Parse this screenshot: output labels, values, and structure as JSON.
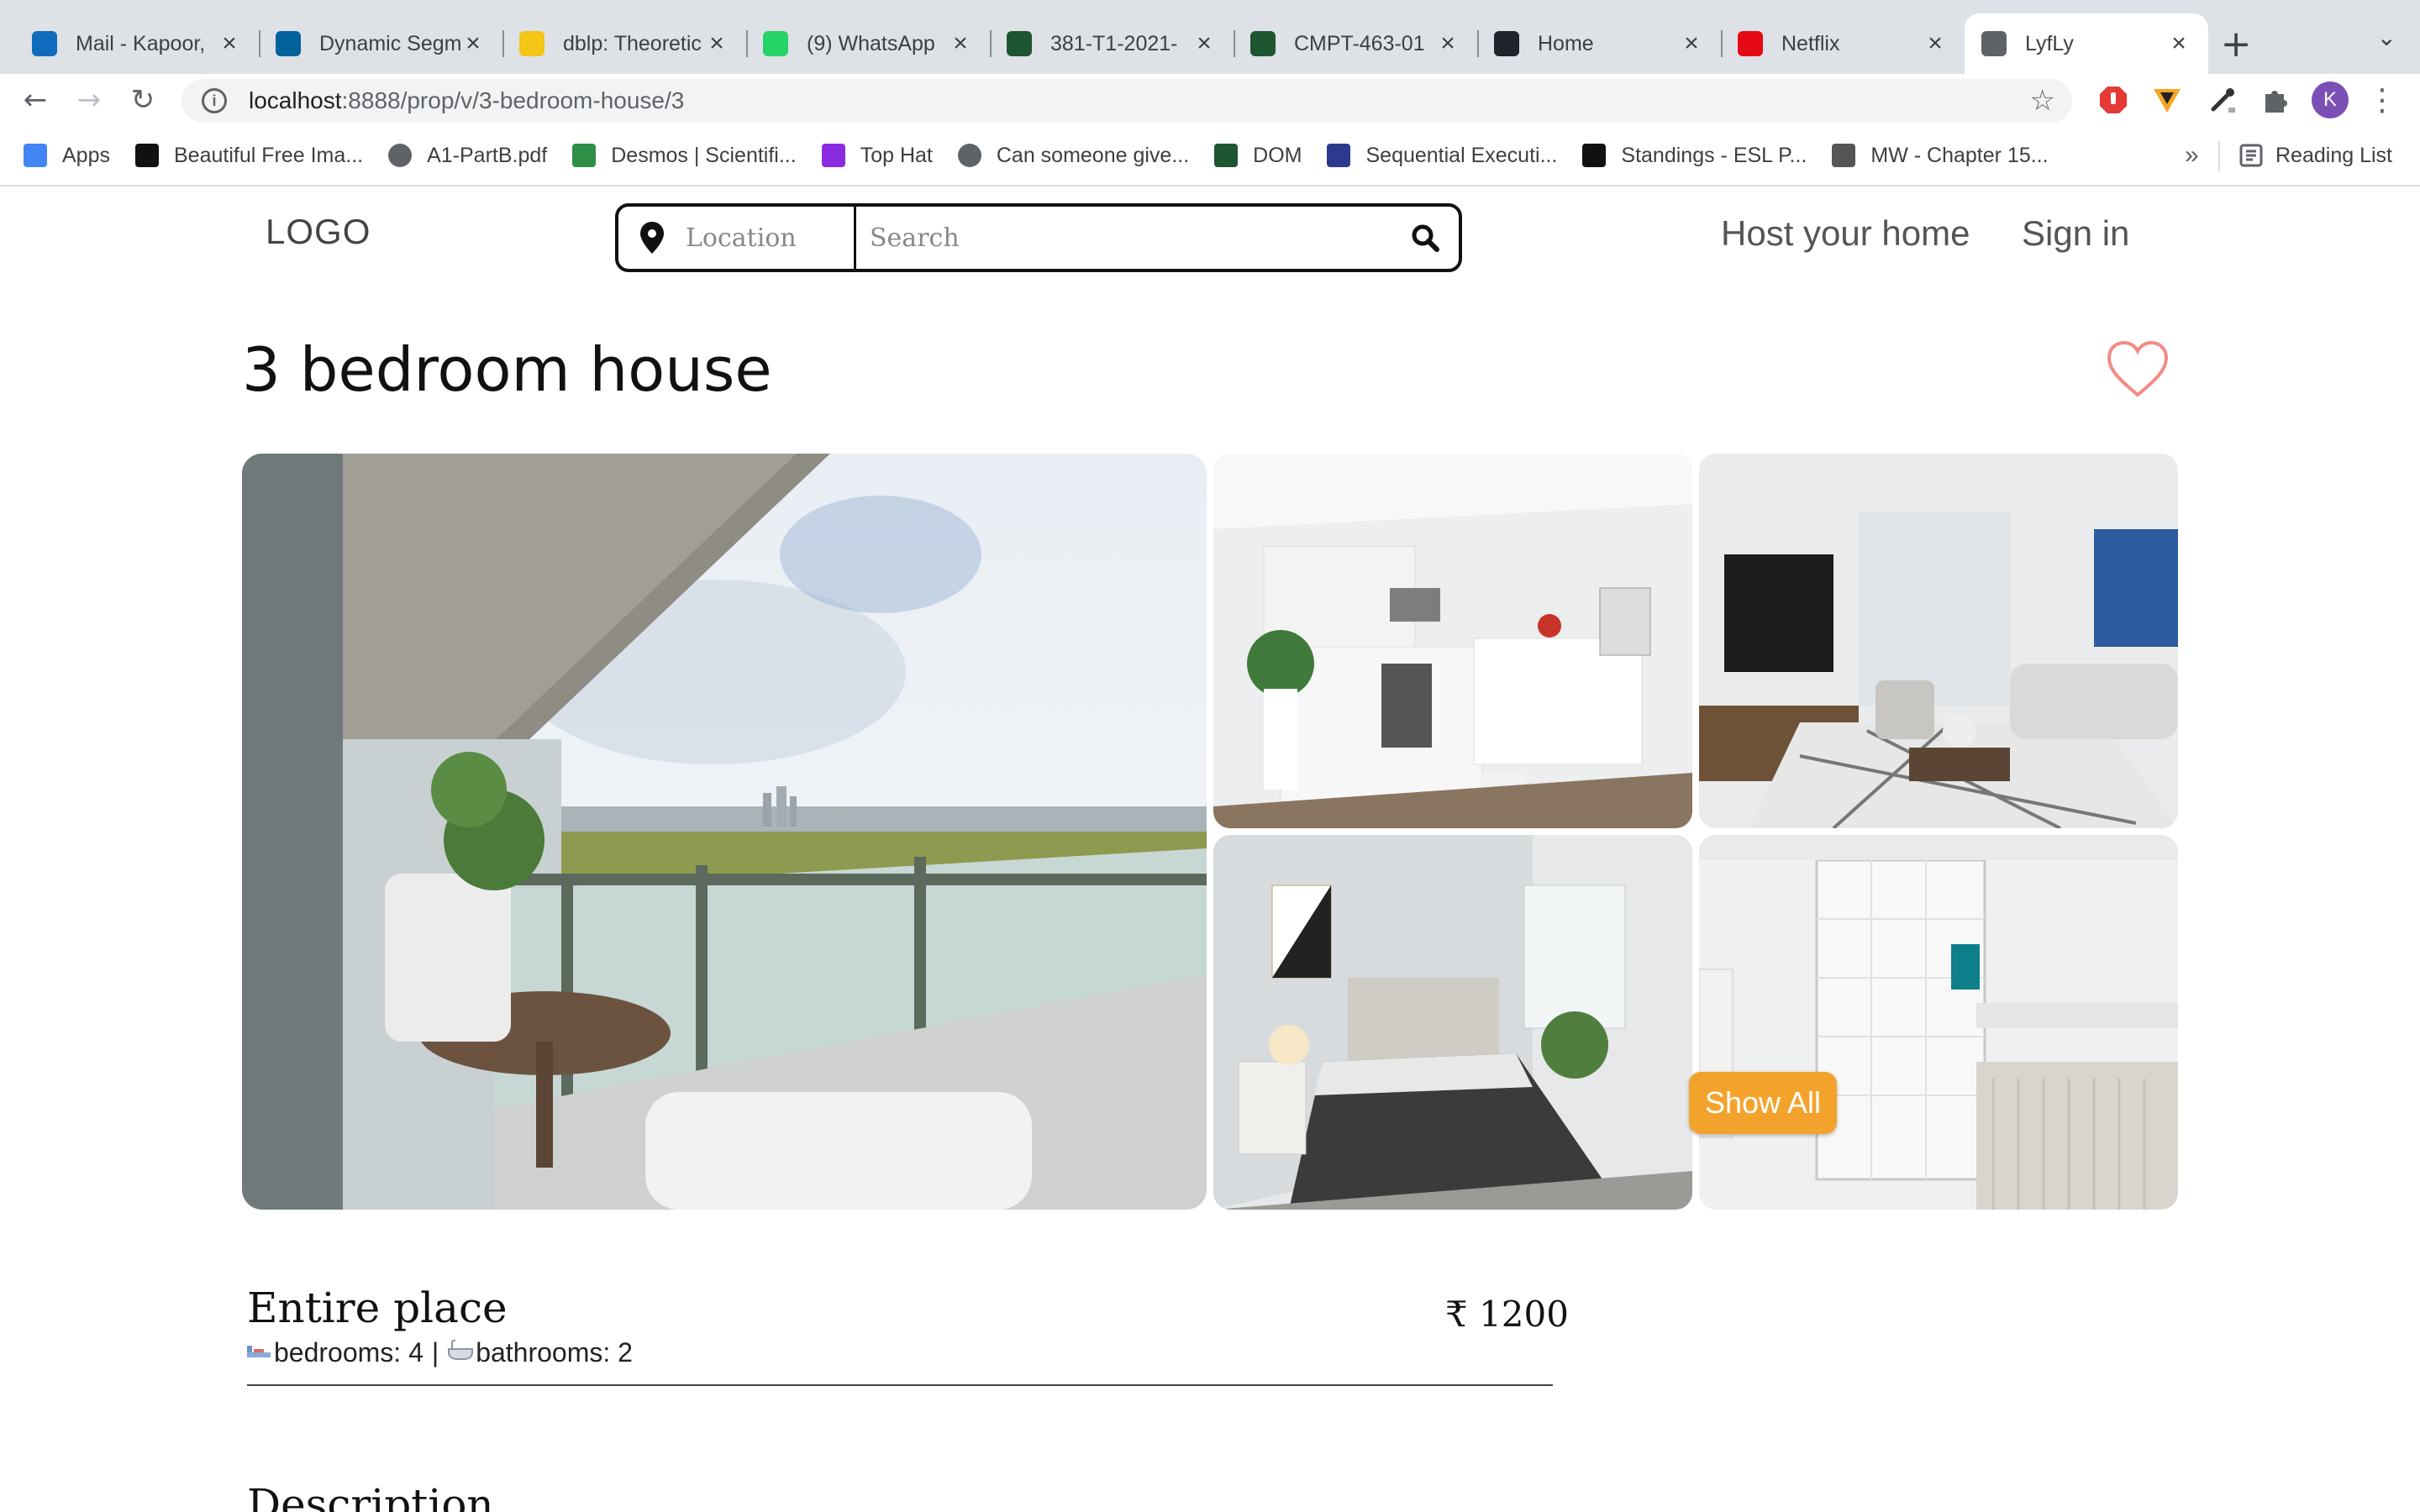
{
  "browser": {
    "tabs": [
      {
        "title": "Mail - Kapoor,",
        "icon": "outlook-icon",
        "color": "#0f6cbd",
        "active": false
      },
      {
        "title": "Dynamic Segm",
        "icon": "ieee-icon",
        "color": "#00629b",
        "active": false
      },
      {
        "title": "dblp: Theoretic",
        "icon": "dblp-icon",
        "color": "#f5c518",
        "active": false
      },
      {
        "title": "(9) WhatsApp",
        "icon": "whatsapp-icon",
        "color": "#25d366",
        "active": false
      },
      {
        "title": "381-T1-2021-",
        "icon": "shield-icon",
        "color": "#1e5631",
        "active": false
      },
      {
        "title": "CMPT-463-01",
        "icon": "shield-icon",
        "color": "#1e5631",
        "active": false
      },
      {
        "title": "Home",
        "icon": "react-icon",
        "color": "#20232a",
        "active": false
      },
      {
        "title": "Netflix",
        "icon": "netflix-icon",
        "color": "#e50914",
        "active": false
      },
      {
        "title": "LyfLy",
        "icon": "globe-icon",
        "color": "#5f6368",
        "active": true
      }
    ],
    "url_host": "localhost",
    "url_rest": ":8888/prop/v/3-bedroom-house/3",
    "avatar_letter": "K",
    "bookmarks": [
      {
        "label": "Apps",
        "icon": "apps-grid-icon",
        "color": "#4285f4"
      },
      {
        "label": "Beautiful Free Ima...",
        "icon": "unsplash-icon",
        "color": "#111111"
      },
      {
        "label": "A1-PartB.pdf",
        "icon": "globe-icon",
        "color": "#5f6368"
      },
      {
        "label": "Desmos | Scientifi...",
        "icon": "desmos-icon",
        "color": "#2f8f46"
      },
      {
        "label": "Top Hat",
        "icon": "tophat-icon",
        "color": "#8a2be2"
      },
      {
        "label": "Can someone give...",
        "icon": "globe-icon",
        "color": "#5f6368"
      },
      {
        "label": "DOM",
        "icon": "shield-icon",
        "color": "#1e5631"
      },
      {
        "label": "Sequential Executi...",
        "icon": "next-icon",
        "color": "#2b3a8c"
      },
      {
        "label": "Standings - ESL P...",
        "icon": "league-icon",
        "color": "#111111"
      },
      {
        "label": "MW - Chapter 15...",
        "icon": "mw-icon",
        "color": "#555555"
      }
    ],
    "more_label": "»",
    "reading_list": "Reading List"
  },
  "site": {
    "logo": "LOGO",
    "location_placeholder": "Location",
    "search_placeholder": "Search",
    "host_link": "Host your home",
    "signin_link": "Sign in"
  },
  "listing": {
    "title": "3 bedroom house",
    "show_all": "Show All",
    "type": "Entire place",
    "price": "₹ 1200",
    "bedrooms_label": "bedrooms: 4",
    "separator": "|",
    "bathrooms_label": "bathrooms: 2",
    "description_heading": "Description",
    "photos": [
      "balcony",
      "kitchen",
      "living-room",
      "bedroom",
      "bathroom"
    ]
  },
  "colors": {
    "accent": "#f3a32c",
    "heart": "#f28b82"
  }
}
